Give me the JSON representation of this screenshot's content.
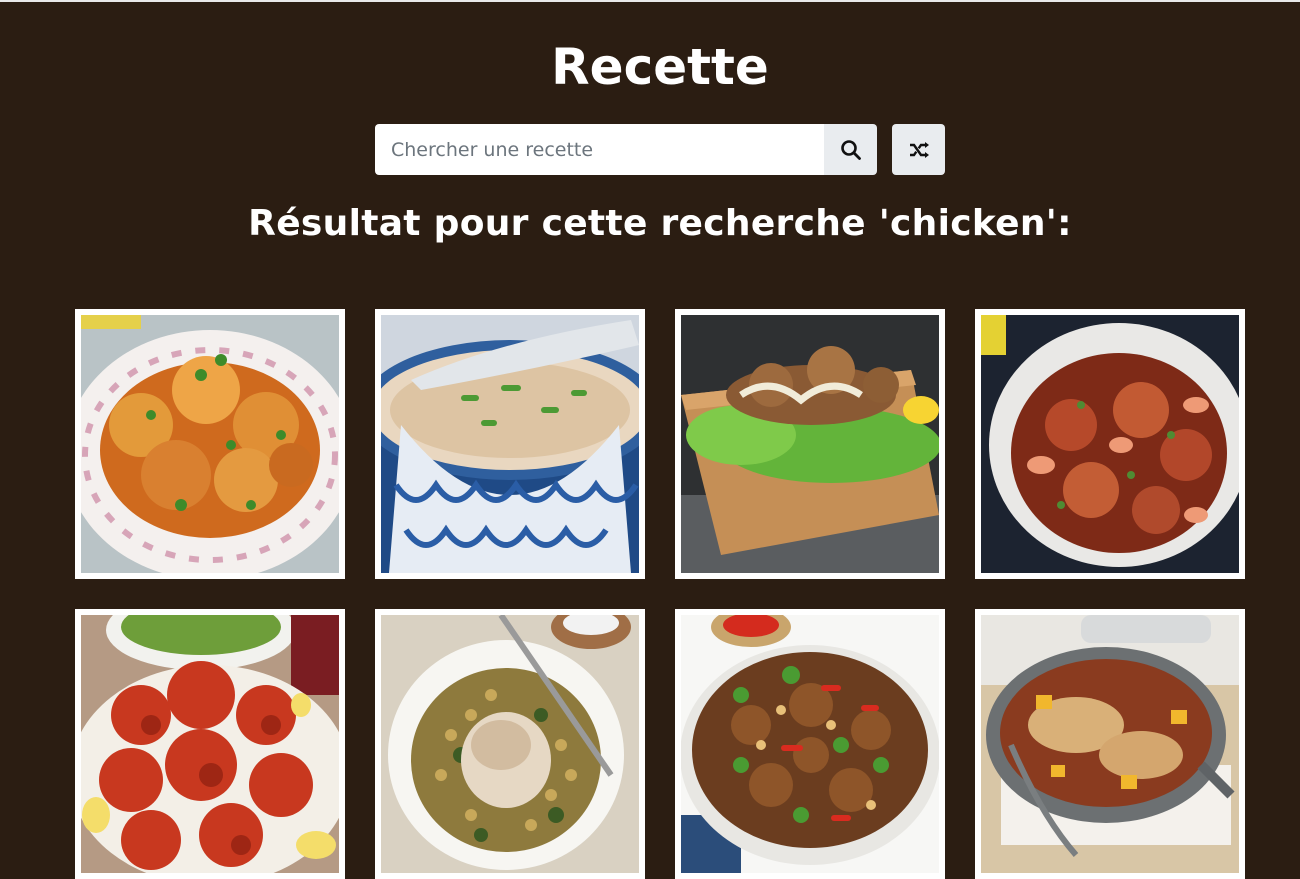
{
  "header": {
    "title": "Recette"
  },
  "search": {
    "placeholder": "Chercher une recette",
    "value": ""
  },
  "icons": {
    "search": "search-icon",
    "random": "shuffle-icon"
  },
  "results": {
    "heading": "Résultat pour cette recherche 'chicken':",
    "meals": [
      {
        "alt": "recipe photo 1"
      },
      {
        "alt": "recipe photo 2"
      },
      {
        "alt": "recipe photo 3"
      },
      {
        "alt": "recipe photo 4"
      },
      {
        "alt": "recipe photo 5"
      },
      {
        "alt": "recipe photo 6"
      },
      {
        "alt": "recipe photo 7"
      },
      {
        "alt": "recipe photo 8"
      }
    ]
  },
  "colors": {
    "background": "#2b1d12",
    "button": "#e9ecef",
    "text": "#ffffff"
  }
}
